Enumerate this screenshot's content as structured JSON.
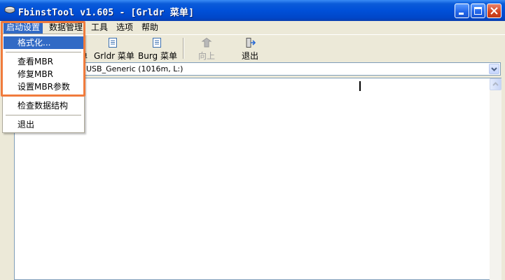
{
  "window": {
    "title": "FbinstTool v1.605 - [Grldr 菜单]"
  },
  "menubar": {
    "items": [
      {
        "label": "启动设置",
        "active": true
      },
      {
        "label": "数据管理",
        "active": false
      },
      {
        "label": "工具",
        "active": false
      },
      {
        "label": "选项",
        "active": false
      },
      {
        "label": "帮助",
        "active": false
      }
    ]
  },
  "toolbar": {
    "partial_label": "单",
    "grldr_menu_label": "Grldr 菜单",
    "burg_menu_label": "Burg 菜单",
    "up_label": "向上",
    "exit_label": "退出"
  },
  "device_combo": {
    "value": "USB_Generic  (1016m, L:)"
  },
  "dropdown": {
    "items": [
      {
        "label": "格式化..."
      },
      {
        "label": "查看MBR"
      },
      {
        "label": "修复MBR"
      },
      {
        "label": "设置MBR参数"
      },
      {
        "label": "检查数据结构"
      },
      {
        "label": "退出"
      }
    ]
  },
  "colors": {
    "titlebar": "#0050d8",
    "highlight": "#316ac5",
    "annotation": "#f07b3c",
    "face": "#ece9d8"
  }
}
